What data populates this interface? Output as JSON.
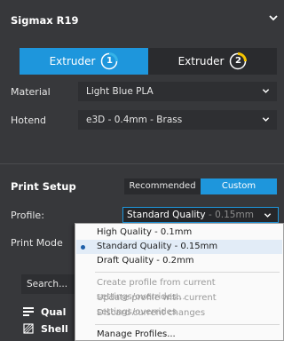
{
  "printer": {
    "name": "Sigmax R19",
    "icon": "chevron-down-icon"
  },
  "extruders": [
    {
      "label": "Extruder",
      "number": "1",
      "active": true,
      "color": "#36b3e8"
    },
    {
      "label": "Extruder",
      "number": "2",
      "active": false,
      "color": "#f5c400"
    }
  ],
  "material": {
    "label": "Material",
    "value": "Light Blue PLA"
  },
  "hotend": {
    "label": "Hotend",
    "value": "e3D - 0.4mm - Brass"
  },
  "print_setup": {
    "title": "Print Setup",
    "modes": [
      "Recommended",
      "Custom"
    ],
    "active_mode": "Custom",
    "profile_label": "Profile:",
    "profile_value": "Standard Quality",
    "profile_suffix": " - 0.15mm",
    "print_mode_label": "Print Mode",
    "search_placeholder": "Search..."
  },
  "categories": [
    {
      "label": "Qual",
      "icon": "quality-icon"
    },
    {
      "label": "Shell",
      "icon": "shell-icon"
    }
  ],
  "profile_menu": {
    "items": [
      {
        "label": "High Quality - 0.1mm",
        "enabled": true,
        "selected": false
      },
      {
        "label": "Standard Quality - 0.15mm",
        "enabled": true,
        "selected": true
      },
      {
        "label": "Draft Quality - 0.2mm",
        "enabled": true,
        "selected": false
      },
      {
        "label": "Create profile from current settings/overrides...",
        "enabled": false
      },
      {
        "label": "Update profile with current settings/overrides",
        "enabled": false
      },
      {
        "label": "Discard current changes",
        "enabled": false
      },
      {
        "label": "Manage Profiles...",
        "enabled": true
      }
    ]
  },
  "colors": {
    "accent": "#1e96dc",
    "background": "#37383b",
    "menu_bg": "#fafafa"
  }
}
